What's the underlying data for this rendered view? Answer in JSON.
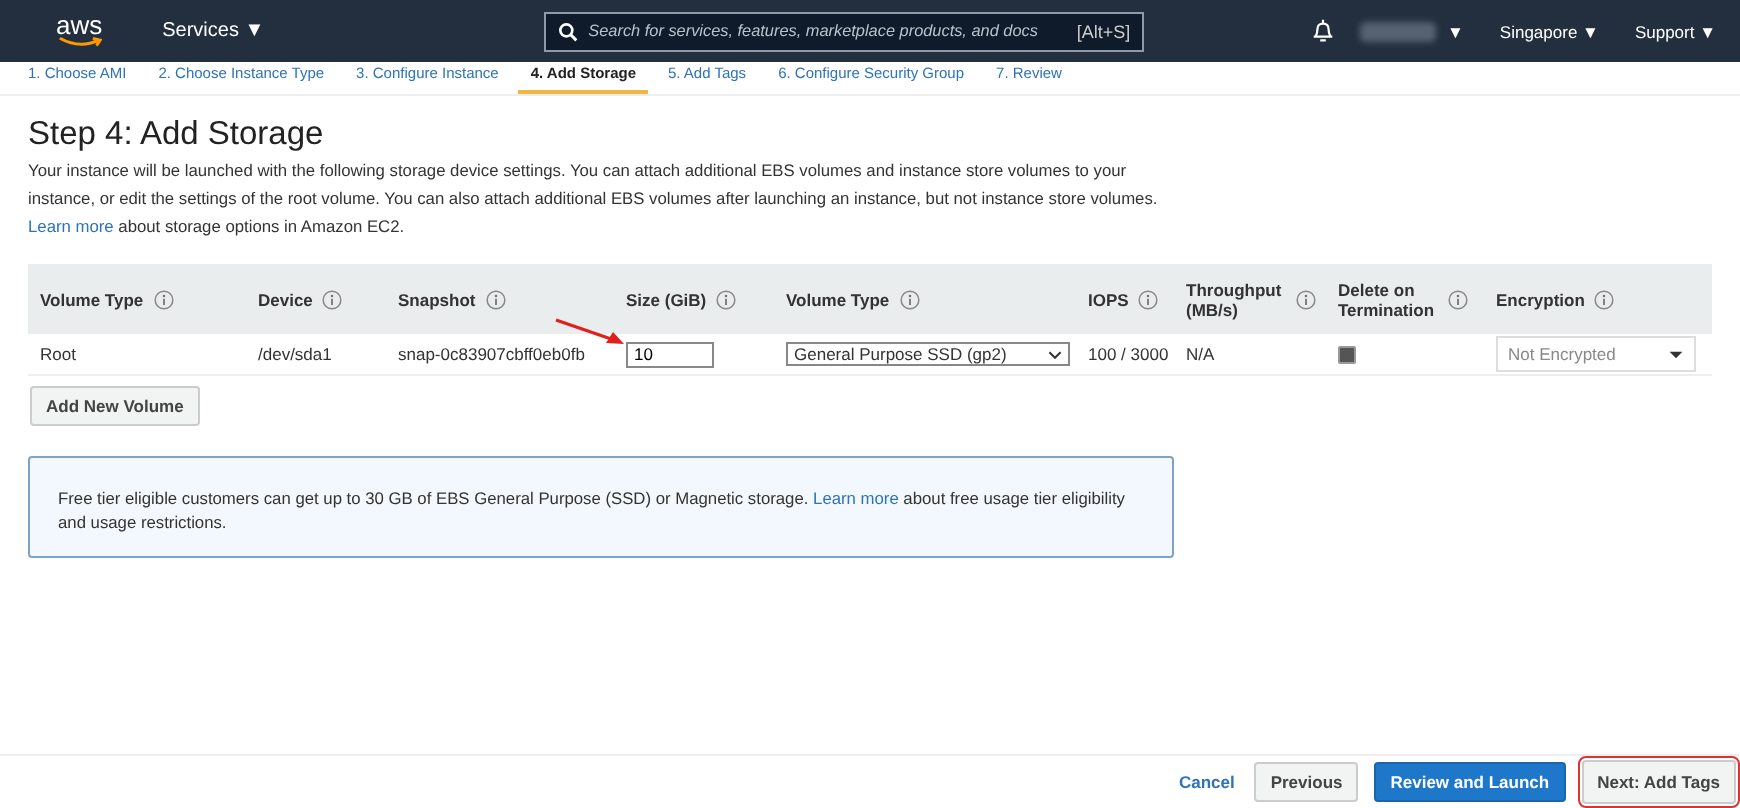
{
  "nav": {
    "logo": "aws",
    "services": "Services ▼",
    "search": {
      "placeholder": "Search for services, features, marketplace products, and docs",
      "shortcut": "[Alt+S]"
    },
    "menus": [
      "▼",
      "Singapore ▼",
      "Support ▼"
    ]
  },
  "steps": [
    {
      "label": "1. Choose AMI",
      "selected": false
    },
    {
      "label": "2. Choose Instance Type",
      "selected": false
    },
    {
      "label": "3. Configure Instance",
      "selected": false
    },
    {
      "label": "4. Add Storage",
      "selected": true
    },
    {
      "label": "5. Add Tags",
      "selected": false
    },
    {
      "label": "6. Configure Security Group",
      "selected": false
    },
    {
      "label": "7. Review",
      "selected": false
    }
  ],
  "title": "Step 4: Add Storage",
  "intro": {
    "text": "Your instance will be launched with the following storage device settings. You can attach additional EBS volumes and instance store volumes to your instance, or edit the settings of the root volume. You can also attach additional EBS volumes after launching an instance, but not instance store volumes.",
    "link": "Learn more",
    "after": "about storage options in Amazon EC2."
  },
  "table": {
    "columns": [
      {
        "label": "Volume Type"
      },
      {
        "label": "Device"
      },
      {
        "label": "Snapshot"
      },
      {
        "label": "Size (GiB)"
      },
      {
        "label": "Volume Type"
      },
      {
        "label": "IOPS"
      },
      {
        "label": "Throughput (MB/s)"
      },
      {
        "label": "Delete on Termination"
      },
      {
        "label": "Encryption"
      }
    ],
    "rows": [
      {
        "volume_type": "Root",
        "device": "/dev/sda1",
        "snapshot": "snap-0c83907cbff0eb0fb",
        "size": "10",
        "ebs_type": "General Purpose SSD (gp2)",
        "iops": "100 / 3000",
        "throughput": "N/A",
        "delete_on_termination": true,
        "encryption": "Not Encrypted"
      }
    ]
  },
  "add_button": "Add New Volume",
  "info": {
    "text": "Free tier eligible customers can get up to 30 GB of EBS General Purpose (SSD) or Magnetic storage.",
    "link": "Learn more",
    "after": "about free usage tier eligibility and usage restrictions."
  },
  "footer": {
    "cancel": "Cancel",
    "previous": "Previous",
    "review": "Review and Launch",
    "next": "Next: Add Tags"
  }
}
